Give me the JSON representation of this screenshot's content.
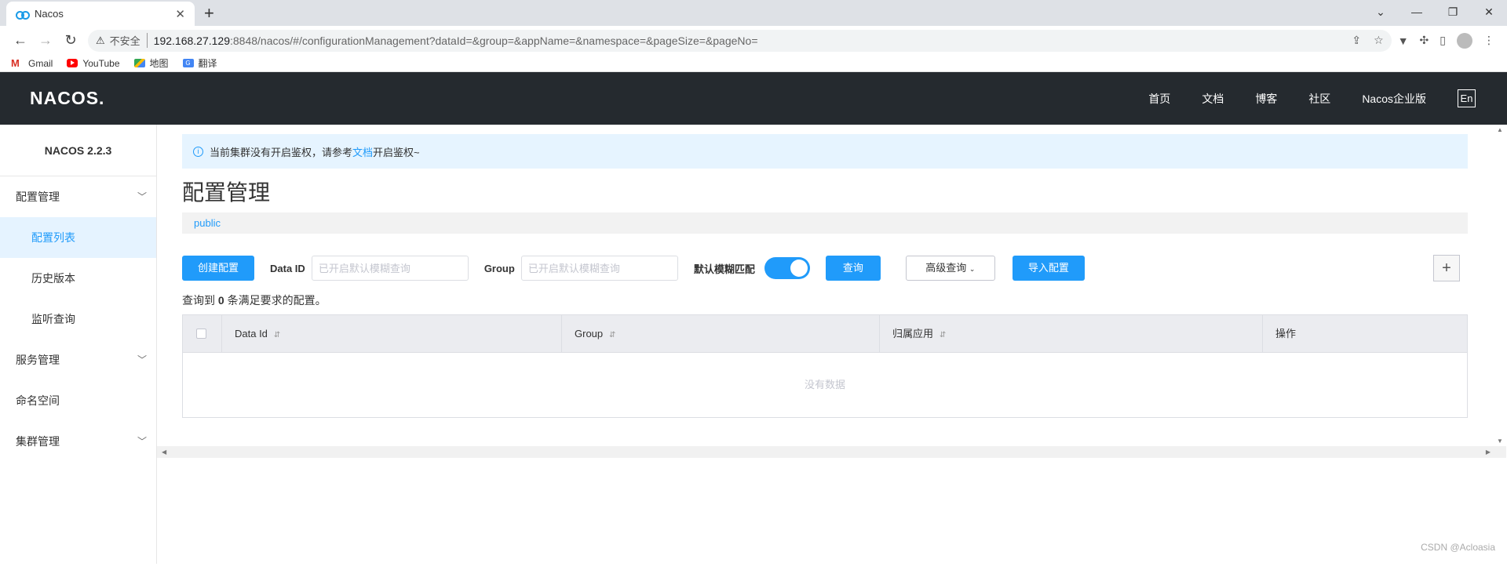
{
  "browser": {
    "tab_title": "Nacos",
    "tab_close": "✕",
    "new_tab": "+",
    "insecure_label": "不安全",
    "url_host": "192.168.27.129",
    "url_rest": ":8848/nacos/#/configurationManagement?dataId=&group=&appName=&namespace=&pageSize=&pageNo=",
    "bookmarks": [
      {
        "label": "Gmail"
      },
      {
        "label": "YouTube"
      },
      {
        "label": "地图"
      },
      {
        "label": "翻译"
      }
    ]
  },
  "header": {
    "logo": "NACOS.",
    "nav": [
      "首页",
      "文档",
      "博客",
      "社区",
      "Nacos企业版"
    ],
    "lang": "En"
  },
  "sidebar": {
    "version": "NACOS 2.2.3",
    "groups": [
      {
        "label": "配置管理"
      },
      {
        "label": "服务管理"
      },
      {
        "label": "命名空间"
      },
      {
        "label": "集群管理"
      }
    ],
    "config_items": [
      {
        "label": "配置列表"
      },
      {
        "label": "历史版本"
      },
      {
        "label": "监听查询"
      }
    ]
  },
  "notice": {
    "before": "当前集群没有开启鉴权，请参考",
    "link": "文档",
    "after": "开启鉴权~"
  },
  "main": {
    "title": "配置管理",
    "namespace": "public",
    "create_button": "创建配置",
    "dataid_label": "Data ID",
    "dataid_placeholder": "已开启默认模糊查询",
    "group_label": "Group",
    "group_placeholder": "已开启默认模糊查询",
    "fuzzy_label": "默认模糊匹配",
    "fuzzy_on": true,
    "query_button": "查询",
    "advanced_button": "高级查询",
    "import_button": "导入配置",
    "result_prefix": "查询到",
    "result_count": "0",
    "result_suffix": "条满足要求的配置。",
    "columns": [
      "Data Id",
      "Group",
      "归属应用",
      "操作"
    ],
    "empty_text": "没有数据"
  },
  "watermark": "CSDN @Acloasia"
}
